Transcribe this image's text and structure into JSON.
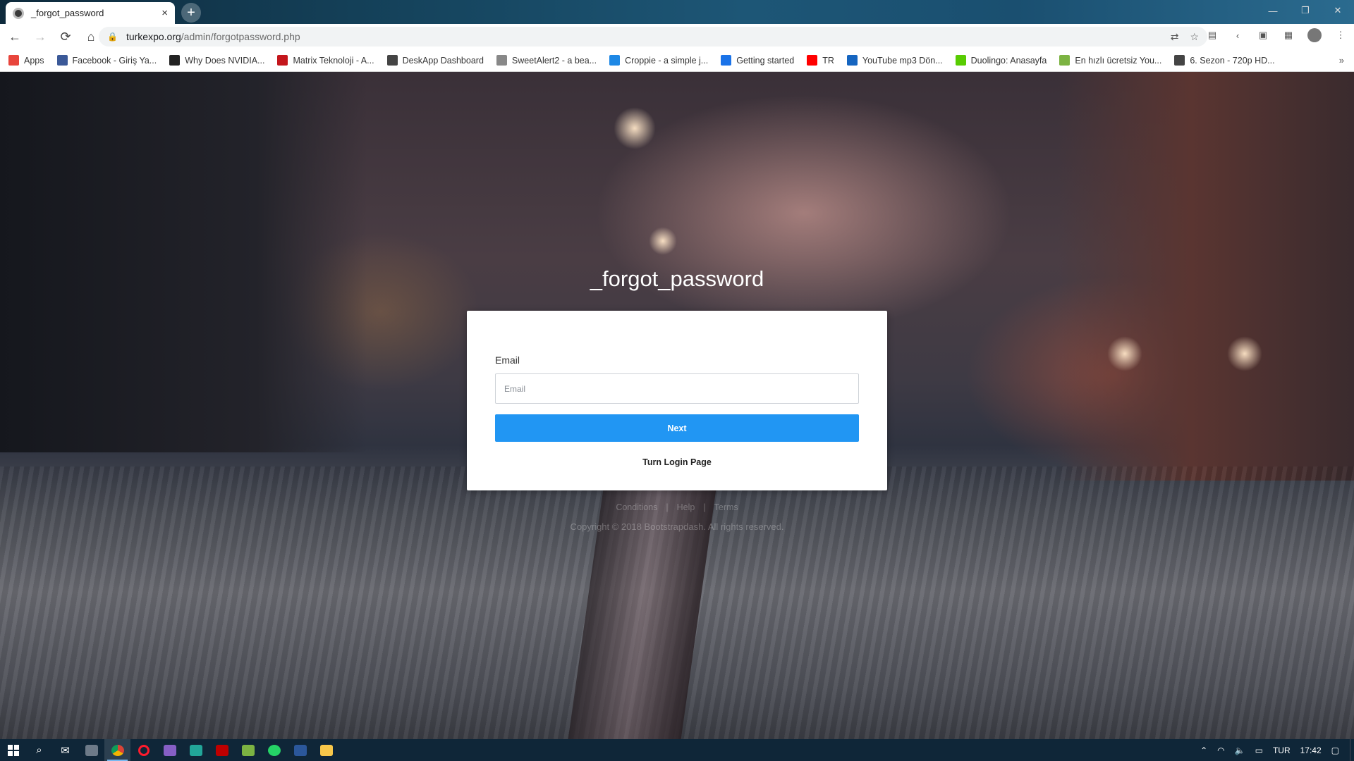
{
  "browser": {
    "tab_title": "_forgot_password",
    "tab_close": "×",
    "new_tab": "+",
    "window_controls": {
      "minimize": "—",
      "maximize": "❐",
      "close": "✕"
    },
    "url_host": "turkexpo.org",
    "url_path": "/admin/forgotpassword.php",
    "nav": {
      "back": "←",
      "forward": "→",
      "reload": "⟳",
      "home": "⌂"
    },
    "bookmarks": [
      {
        "label": "Apps",
        "color": "#e8453c"
      },
      {
        "label": "Facebook - Giriş Ya...",
        "color": "#3b5998"
      },
      {
        "label": "Why Does NVIDIA...",
        "color": "#222222"
      },
      {
        "label": "Matrix Teknoloji - A...",
        "color": "#c4161c"
      },
      {
        "label": "DeskApp Dashboard",
        "color": "#444444"
      },
      {
        "label": "SweetAlert2 - a bea...",
        "color": "#888888"
      },
      {
        "label": "Croppie - a simple j...",
        "color": "#1e88e5"
      },
      {
        "label": "Getting started",
        "color": "#1a73e8"
      },
      {
        "label": "TR",
        "color": "#ff0000"
      },
      {
        "label": "YouTube mp3 Dön...",
        "color": "#1565c0"
      },
      {
        "label": "Duolingo: Anasayfa",
        "color": "#58cc02"
      },
      {
        "label": "En hızlı ücretsiz You...",
        "color": "#7cb342"
      },
      {
        "label": "6. Sezon - 720p HD...",
        "color": "#444444"
      }
    ],
    "bookmarks_more": "»"
  },
  "page": {
    "title": "_forgot_password",
    "email_label": "Email",
    "email_placeholder": "Email",
    "email_value": "",
    "next_button": "Next",
    "login_link": "Turn Login Page",
    "footer_links": [
      "Conditions",
      "|",
      "Help",
      "|",
      "Terms"
    ],
    "copyright": "Copyright © 2018 Bootstrapdash. All rights reserved."
  },
  "taskbar": {
    "tray_language": "TUR",
    "clock": "17:42"
  },
  "colors": {
    "accent": "#2196f3",
    "taskbar": "#0f2638"
  }
}
